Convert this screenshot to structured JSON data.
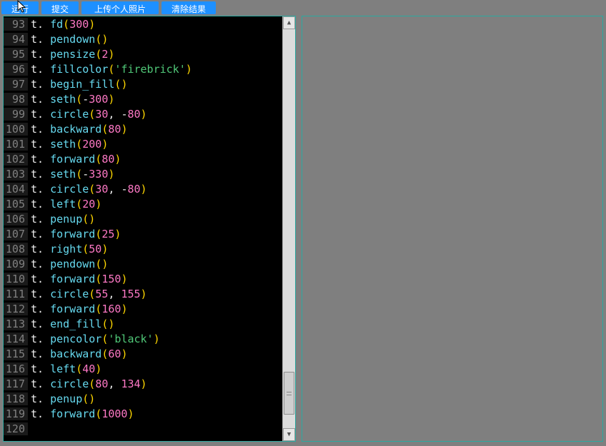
{
  "toolbar": {
    "run": "运行",
    "submit": "提交",
    "upload": "上传个人照片",
    "clear": "清除结果"
  },
  "gutter": [
    "93",
    "94",
    "95",
    "96",
    "97",
    "98",
    "99",
    "100",
    "101",
    "102",
    "103",
    "104",
    "105",
    "106",
    "107",
    "108",
    "109",
    "110",
    "111",
    "112",
    "113",
    "114",
    "115",
    "116",
    "117",
    "118",
    "119",
    "120"
  ],
  "code": [
    [
      [
        "var",
        "t"
      ],
      [
        "dot",
        "."
      ],
      [
        "ws",
        " "
      ],
      [
        "func",
        "fd"
      ],
      [
        "paren",
        "("
      ],
      [
        "num",
        "300"
      ],
      [
        "paren",
        ")"
      ]
    ],
    [
      [
        "var",
        "t"
      ],
      [
        "dot",
        "."
      ],
      [
        "ws",
        " "
      ],
      [
        "func",
        "pendown"
      ],
      [
        "paren",
        "("
      ],
      [
        "paren",
        ")"
      ]
    ],
    [
      [
        "var",
        "t"
      ],
      [
        "dot",
        "."
      ],
      [
        "ws",
        " "
      ],
      [
        "func",
        "pensize"
      ],
      [
        "paren",
        "("
      ],
      [
        "num",
        "2"
      ],
      [
        "paren",
        ")"
      ]
    ],
    [
      [
        "var",
        "t"
      ],
      [
        "dot",
        "."
      ],
      [
        "ws",
        " "
      ],
      [
        "func",
        "fillcolor"
      ],
      [
        "paren",
        "("
      ],
      [
        "str",
        "'firebrick'"
      ],
      [
        "paren",
        ")"
      ]
    ],
    [
      [
        "var",
        "t"
      ],
      [
        "dot",
        "."
      ],
      [
        "ws",
        " "
      ],
      [
        "func",
        "begin_fill"
      ],
      [
        "paren",
        "("
      ],
      [
        "paren",
        ")"
      ]
    ],
    [
      [
        "var",
        "t"
      ],
      [
        "dot",
        "."
      ],
      [
        "ws",
        " "
      ],
      [
        "func",
        "seth"
      ],
      [
        "paren",
        "("
      ],
      [
        "op",
        "-"
      ],
      [
        "num",
        "300"
      ],
      [
        "paren",
        ")"
      ]
    ],
    [
      [
        "var",
        "t"
      ],
      [
        "dot",
        "."
      ],
      [
        "ws",
        " "
      ],
      [
        "func",
        "circle"
      ],
      [
        "paren",
        "("
      ],
      [
        "num",
        "30"
      ],
      [
        "op",
        ","
      ],
      [
        "ws",
        " "
      ],
      [
        "op",
        "-"
      ],
      [
        "num",
        "80"
      ],
      [
        "paren",
        ")"
      ]
    ],
    [
      [
        "var",
        "t"
      ],
      [
        "dot",
        "."
      ],
      [
        "ws",
        " "
      ],
      [
        "func",
        "backward"
      ],
      [
        "paren",
        "("
      ],
      [
        "num",
        "80"
      ],
      [
        "paren",
        ")"
      ]
    ],
    [
      [
        "var",
        "t"
      ],
      [
        "dot",
        "."
      ],
      [
        "ws",
        " "
      ],
      [
        "func",
        "seth"
      ],
      [
        "paren",
        "("
      ],
      [
        "num",
        "200"
      ],
      [
        "paren",
        ")"
      ]
    ],
    [
      [
        "var",
        "t"
      ],
      [
        "dot",
        "."
      ],
      [
        "ws",
        " "
      ],
      [
        "func",
        "forward"
      ],
      [
        "paren",
        "("
      ],
      [
        "num",
        "80"
      ],
      [
        "paren",
        ")"
      ]
    ],
    [
      [
        "var",
        "t"
      ],
      [
        "dot",
        "."
      ],
      [
        "ws",
        " "
      ],
      [
        "func",
        "seth"
      ],
      [
        "paren",
        "("
      ],
      [
        "op",
        "-"
      ],
      [
        "num",
        "330"
      ],
      [
        "paren",
        ")"
      ]
    ],
    [
      [
        "var",
        "t"
      ],
      [
        "dot",
        "."
      ],
      [
        "ws",
        " "
      ],
      [
        "func",
        "circle"
      ],
      [
        "paren",
        "("
      ],
      [
        "num",
        "30"
      ],
      [
        "op",
        ","
      ],
      [
        "ws",
        " "
      ],
      [
        "op",
        "-"
      ],
      [
        "num",
        "80"
      ],
      [
        "paren",
        ")"
      ]
    ],
    [
      [
        "var",
        "t"
      ],
      [
        "dot",
        "."
      ],
      [
        "ws",
        " "
      ],
      [
        "func",
        "left"
      ],
      [
        "paren",
        "("
      ],
      [
        "num",
        "20"
      ],
      [
        "paren",
        ")"
      ]
    ],
    [
      [
        "var",
        "t"
      ],
      [
        "dot",
        "."
      ],
      [
        "ws",
        " "
      ],
      [
        "func",
        "penup"
      ],
      [
        "paren",
        "("
      ],
      [
        "paren",
        ")"
      ]
    ],
    [
      [
        "var",
        "t"
      ],
      [
        "dot",
        "."
      ],
      [
        "ws",
        " "
      ],
      [
        "func",
        "forward"
      ],
      [
        "paren",
        "("
      ],
      [
        "num",
        "25"
      ],
      [
        "paren",
        ")"
      ]
    ],
    [
      [
        "var",
        "t"
      ],
      [
        "dot",
        "."
      ],
      [
        "ws",
        " "
      ],
      [
        "func",
        "right"
      ],
      [
        "paren",
        "("
      ],
      [
        "num",
        "50"
      ],
      [
        "paren",
        ")"
      ]
    ],
    [
      [
        "var",
        "t"
      ],
      [
        "dot",
        "."
      ],
      [
        "ws",
        " "
      ],
      [
        "func",
        "pendown"
      ],
      [
        "paren",
        "("
      ],
      [
        "paren",
        ")"
      ]
    ],
    [
      [
        "var",
        "t"
      ],
      [
        "dot",
        "."
      ],
      [
        "ws",
        " "
      ],
      [
        "func",
        "forward"
      ],
      [
        "paren",
        "("
      ],
      [
        "num",
        "150"
      ],
      [
        "paren",
        ")"
      ]
    ],
    [
      [
        "var",
        "t"
      ],
      [
        "dot",
        "."
      ],
      [
        "ws",
        " "
      ],
      [
        "func",
        "circle"
      ],
      [
        "paren",
        "("
      ],
      [
        "num",
        "55"
      ],
      [
        "op",
        ","
      ],
      [
        "ws",
        " "
      ],
      [
        "num",
        "155"
      ],
      [
        "paren",
        ")"
      ]
    ],
    [
      [
        "var",
        "t"
      ],
      [
        "dot",
        "."
      ],
      [
        "ws",
        " "
      ],
      [
        "func",
        "forward"
      ],
      [
        "paren",
        "("
      ],
      [
        "num",
        "160"
      ],
      [
        "paren",
        ")"
      ]
    ],
    [
      [
        "var",
        "t"
      ],
      [
        "dot",
        "."
      ],
      [
        "ws",
        " "
      ],
      [
        "func",
        "end_fill"
      ],
      [
        "paren",
        "("
      ],
      [
        "paren",
        ")"
      ]
    ],
    [
      [
        "var",
        "t"
      ],
      [
        "dot",
        "."
      ],
      [
        "ws",
        " "
      ],
      [
        "func",
        "pencolor"
      ],
      [
        "paren",
        "("
      ],
      [
        "str",
        "'black'"
      ],
      [
        "paren",
        ")"
      ]
    ],
    [
      [
        "var",
        "t"
      ],
      [
        "dot",
        "."
      ],
      [
        "ws",
        " "
      ],
      [
        "func",
        "backward"
      ],
      [
        "paren",
        "("
      ],
      [
        "num",
        "60"
      ],
      [
        "paren",
        ")"
      ]
    ],
    [
      [
        "var",
        "t"
      ],
      [
        "dot",
        "."
      ],
      [
        "ws",
        " "
      ],
      [
        "func",
        "left"
      ],
      [
        "paren",
        "("
      ],
      [
        "num",
        "40"
      ],
      [
        "paren",
        ")"
      ]
    ],
    [
      [
        "var",
        "t"
      ],
      [
        "dot",
        "."
      ],
      [
        "ws",
        " "
      ],
      [
        "func",
        "circle"
      ],
      [
        "paren",
        "("
      ],
      [
        "num",
        "80"
      ],
      [
        "op",
        ","
      ],
      [
        "ws",
        " "
      ],
      [
        "num",
        "134"
      ],
      [
        "paren",
        ")"
      ]
    ],
    [
      [
        "var",
        "t"
      ],
      [
        "dot",
        "."
      ],
      [
        "ws",
        " "
      ],
      [
        "func",
        "penup"
      ],
      [
        "paren",
        "("
      ],
      [
        "paren",
        ")"
      ]
    ],
    [
      [
        "var",
        "t"
      ],
      [
        "dot",
        "."
      ],
      [
        "ws",
        " "
      ],
      [
        "func",
        "forward"
      ],
      [
        "paren",
        "("
      ],
      [
        "num",
        "1000"
      ],
      [
        "paren",
        ")"
      ]
    ],
    []
  ]
}
